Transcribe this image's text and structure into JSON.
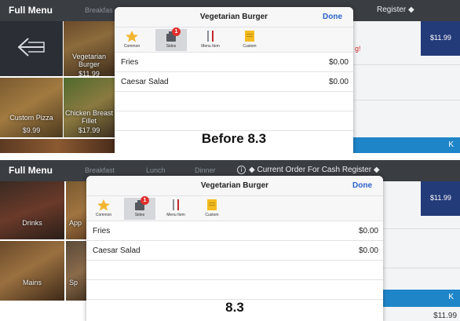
{
  "top": {
    "menu_title": "Full Menu",
    "tabs": [
      "Breakfas"
    ],
    "order_bar_text": "Register",
    "order_diamond": "◆",
    "modal": {
      "title": "Vegetarian Burger",
      "done": "Done",
      "tabs": [
        {
          "label": "Common",
          "icon": "star-icon"
        },
        {
          "label": "Sides",
          "icon": "pot-icon",
          "badge": "1"
        },
        {
          "label": "Menu Item",
          "icon": "fork-knife-icon"
        },
        {
          "label": "Custom",
          "icon": "note-icon"
        }
      ],
      "items": [
        {
          "name": "Fries",
          "price": "$0.00"
        },
        {
          "name": "Caesar Salad",
          "price": "$0.00"
        }
      ]
    },
    "caption": "Before 8.3",
    "tiles": [
      {
        "label": "Vegetarian Burger",
        "price": "$11.99"
      },
      {
        "label": "Custom Pizza",
        "price": "$9.99"
      },
      {
        "label": "Chicken Breast Fillet",
        "price": "$17.99"
      }
    ],
    "right_price": "$11.99",
    "promo": "g!",
    "blue_k": "K"
  },
  "bottom": {
    "menu_title": "Full Menu",
    "tabs": [
      "Breakfast",
      "Lunch",
      "Dinner"
    ],
    "info_icon": "i",
    "order_bar_text": "◆  Current Order For Cash Register  ◆",
    "modal": {
      "title": "Vegetarian Burger",
      "done": "Done",
      "tabs": [
        {
          "label": "Common",
          "icon": "star-icon"
        },
        {
          "label": "Sides",
          "icon": "pot-icon",
          "badge": "1"
        },
        {
          "label": "Menu Item",
          "icon": "fork-knife-icon"
        },
        {
          "label": "Custom",
          "icon": "note-icon"
        }
      ],
      "items": [
        {
          "name": "Fries",
          "price": "$0.00"
        },
        {
          "name": "Caesar Salad",
          "price": "$0.00"
        }
      ]
    },
    "caption": "8.3",
    "tiles": [
      {
        "label": "Drinks"
      },
      {
        "label": "App"
      },
      {
        "label": "Mains"
      },
      {
        "label": "Sp"
      }
    ],
    "right_price": "$11.99",
    "bottom_price": "$11.99",
    "blue_k": "K"
  },
  "colors": {
    "topbar": "#3a3d42",
    "done_link": "#2a63c9",
    "badge": "#e0302e",
    "price_tile": "#243b7a",
    "blue_bar": "#1f85c9"
  }
}
